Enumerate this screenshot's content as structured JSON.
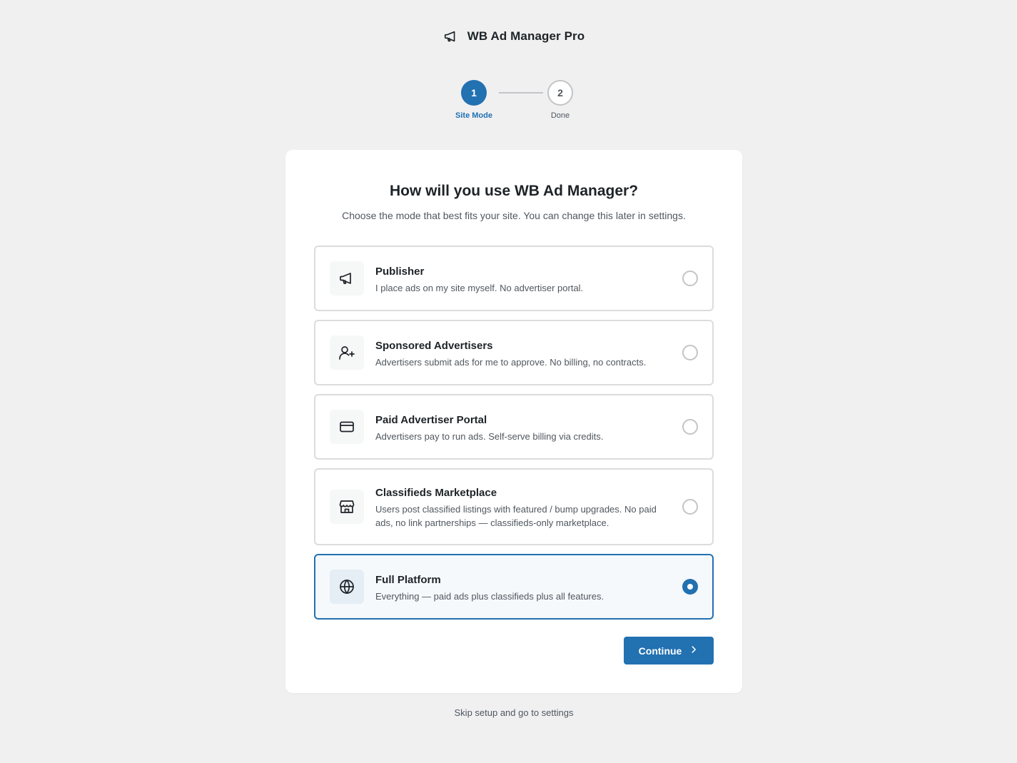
{
  "header": {
    "brand_icon": "megaphone-icon",
    "title": "WB Ad Manager Pro"
  },
  "stepper": {
    "steps": [
      {
        "number": "1",
        "label": "Site Mode",
        "state": "active"
      },
      {
        "number": "2",
        "label": "Done",
        "state": "pending"
      }
    ]
  },
  "card": {
    "title": "How will you use WB Ad Manager?",
    "subtitle": "Choose the mode that best fits your site. You can change this later in settings."
  },
  "options": [
    {
      "icon": "megaphone-icon",
      "title": "Publisher",
      "description": "I place ads on my site myself. No advertiser portal.",
      "selected": false
    },
    {
      "icon": "user-plus-icon",
      "title": "Sponsored Advertisers",
      "description": "Advertisers submit ads for me to approve. No billing, no contracts.",
      "selected": false
    },
    {
      "icon": "credit-card-icon",
      "title": "Paid Advertiser Portal",
      "description": "Advertisers pay to run ads. Self-serve billing via credits.",
      "selected": false
    },
    {
      "icon": "store-icon",
      "title": "Classifieds Marketplace",
      "description": "Users post classified listings with featured / bump upgrades. No paid ads, no link partnerships — classifieds-only marketplace.",
      "selected": false
    },
    {
      "icon": "globe-icon",
      "title": "Full Platform",
      "description": "Everything — paid ads plus classifieds plus all features.",
      "selected": true
    }
  ],
  "actions": {
    "continue_label": "Continue",
    "skip_label": "Skip setup and go to settings"
  },
  "colors": {
    "accent": "#2271b1",
    "background": "#f0f0f1",
    "card": "#ffffff",
    "border": "#dcdcde"
  }
}
